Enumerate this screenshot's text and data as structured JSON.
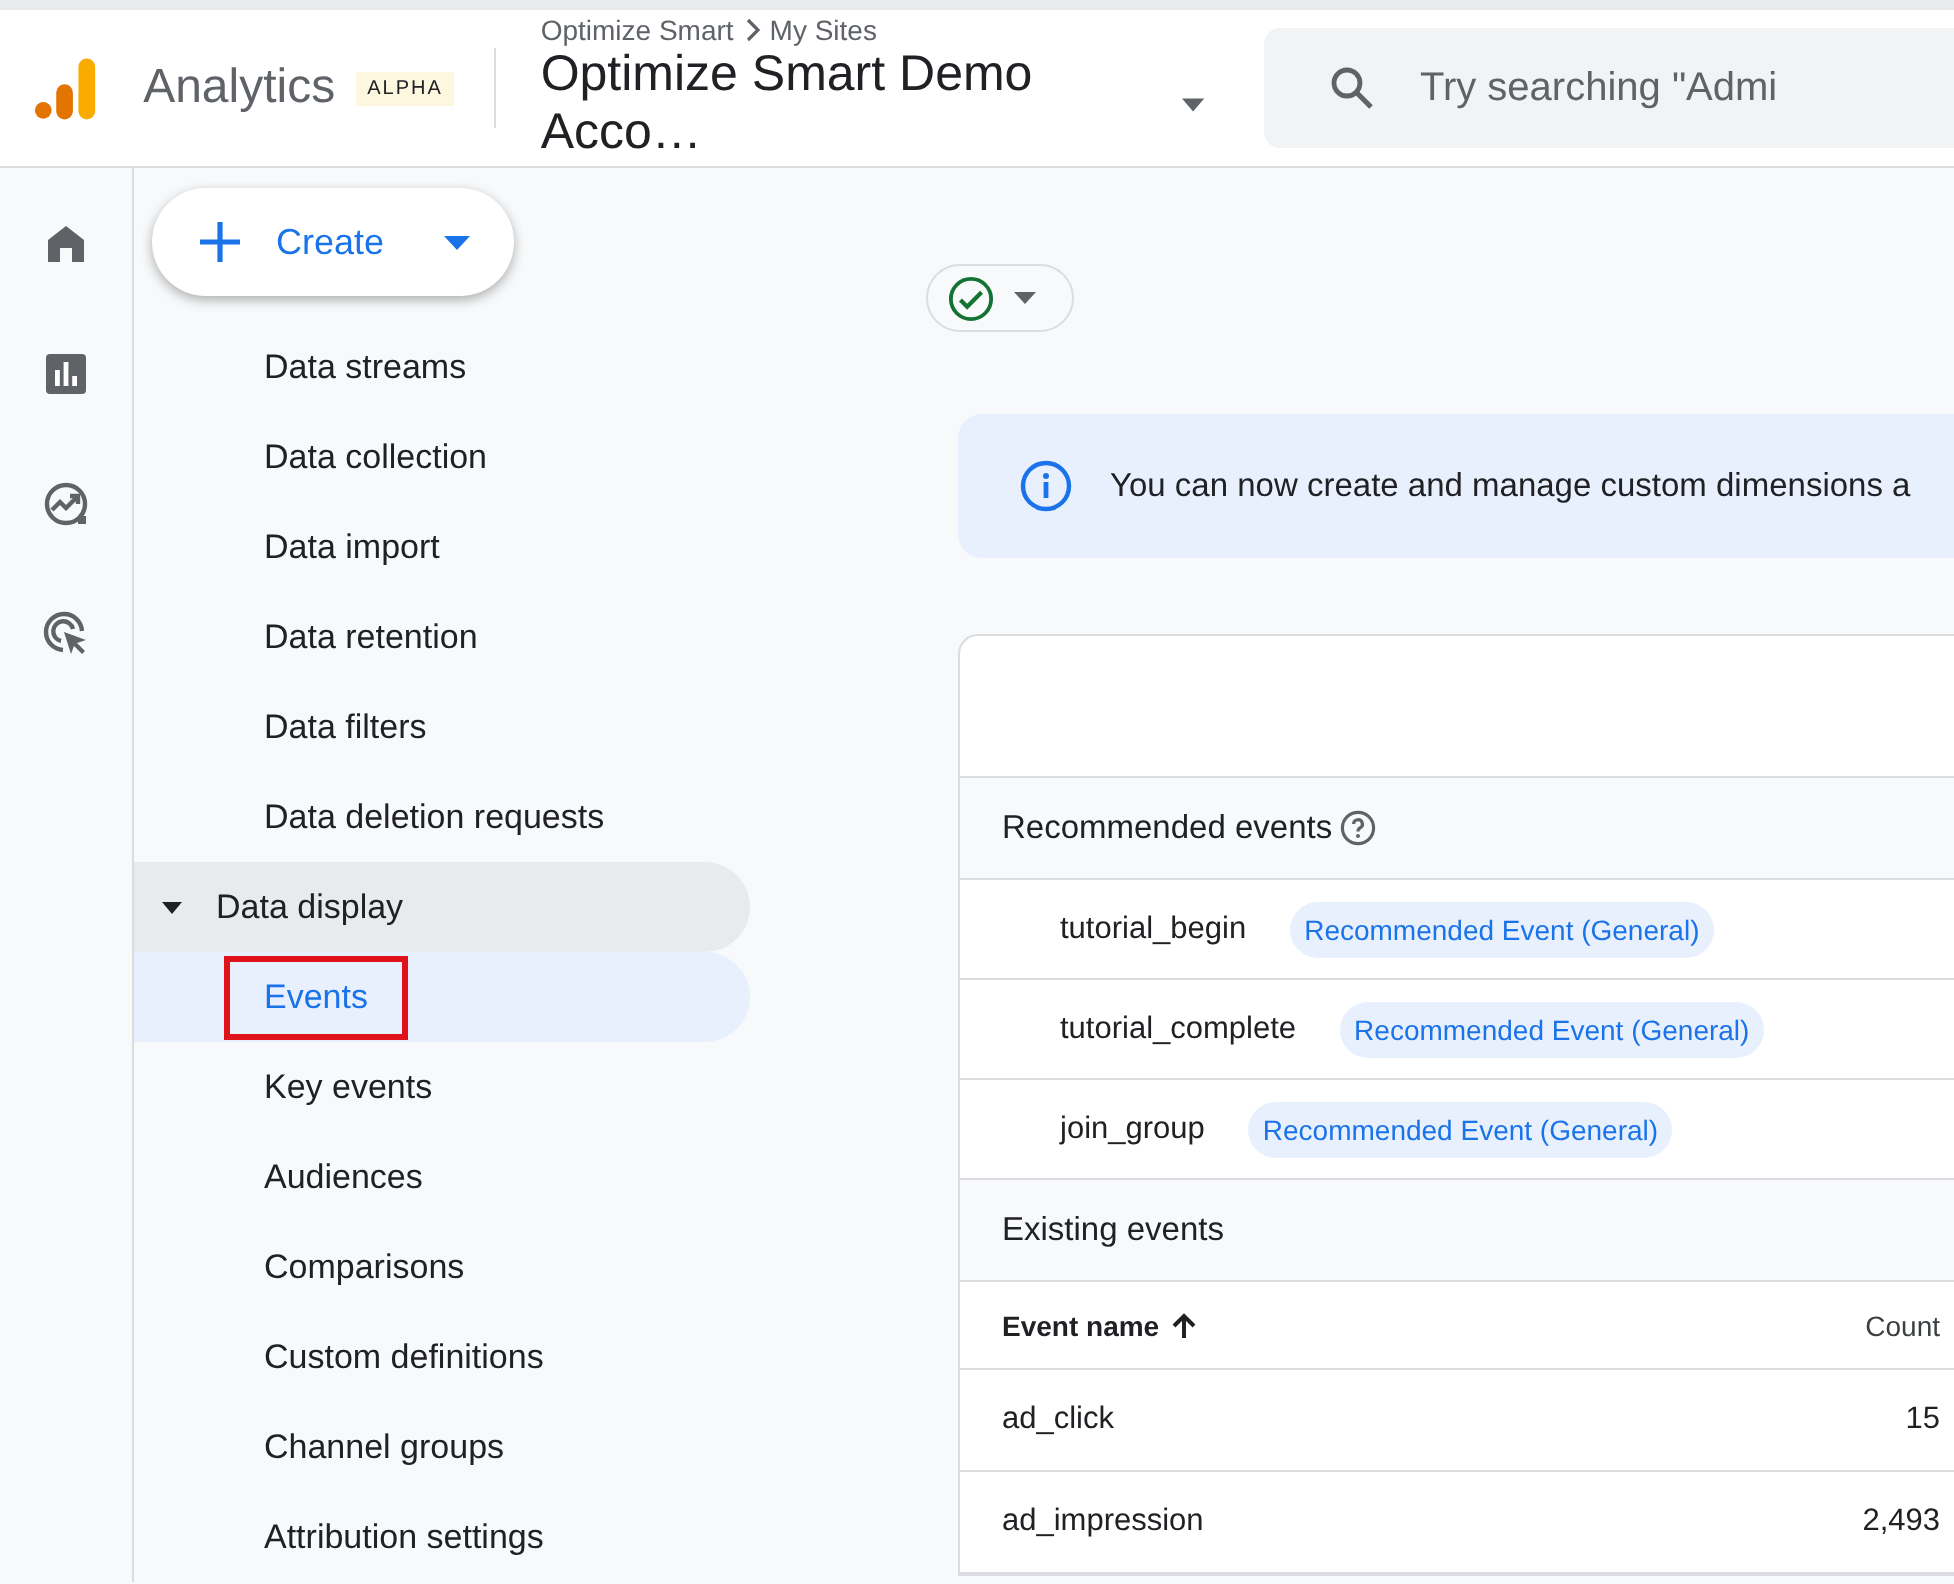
{
  "header": {
    "product": "Analytics",
    "badge": "ALPHA",
    "breadcrumb": [
      "Optimize Smart",
      "My Sites"
    ],
    "property": "Optimize Smart Demo Acco…",
    "search": {
      "placeholder": "Try searching \"Admi"
    }
  },
  "rail": [
    {
      "kind": "home",
      "selected": false
    },
    {
      "kind": "reports",
      "selected": false
    },
    {
      "kind": "explore",
      "selected": false
    },
    {
      "kind": "advertising",
      "selected": false
    }
  ],
  "create_button": {
    "label": "Create"
  },
  "nav": [
    {
      "label": "Data streams",
      "selected": false
    },
    {
      "label": "Data collection",
      "selected": false
    },
    {
      "label": "Data import",
      "selected": false
    },
    {
      "label": "Data retention",
      "selected": false
    },
    {
      "label": "Data filters",
      "selected": false
    },
    {
      "label": "Data deletion requests",
      "selected": false
    },
    {
      "label": "Data display",
      "selected": false,
      "expanded": true,
      "children": [
        {
          "label": "Events",
          "selected": true,
          "highlighted": true
        },
        {
          "label": "Key events",
          "selected": false,
          "highlighted": false
        },
        {
          "label": "Audiences",
          "selected": false,
          "highlighted": false
        },
        {
          "label": "Comparisons",
          "selected": false,
          "highlighted": false
        },
        {
          "label": "Custom definitions",
          "selected": false,
          "highlighted": false
        },
        {
          "label": "Channel groups",
          "selected": false,
          "highlighted": false
        },
        {
          "label": "Attribution settings",
          "selected": false,
          "highlighted": false
        }
      ]
    }
  ],
  "status": {
    "ok": true
  },
  "banner": {
    "text": "You can now create and manage custom dimensions a"
  },
  "recommended": {
    "title": "Recommended events",
    "rows": [
      {
        "name": "tutorial_begin",
        "tag": "Recommended Event (General)"
      },
      {
        "name": "tutorial_complete",
        "tag": "Recommended Event (General)"
      },
      {
        "name": "join_group",
        "tag": "Recommended Event (General)"
      }
    ]
  },
  "existing": {
    "title": "Existing events",
    "columns": [
      "Event name",
      "Count"
    ],
    "rows": [
      [
        "ad_click",
        "15"
      ],
      [
        "ad_impression",
        "2,493"
      ]
    ]
  }
}
